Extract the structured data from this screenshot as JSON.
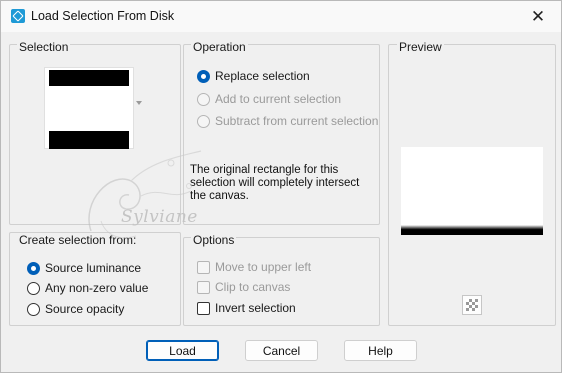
{
  "window": {
    "title": "Load Selection From Disk",
    "close_glyph": "✕"
  },
  "selection": {
    "title": "Selection"
  },
  "operation": {
    "title": "Operation",
    "options": [
      {
        "label": "Replace selection",
        "selected": true,
        "enabled": true
      },
      {
        "label": "Add to current selection",
        "selected": false,
        "enabled": false
      },
      {
        "label": "Subtract from current selection",
        "selected": false,
        "enabled": false
      }
    ],
    "info": "The original rectangle for this selection will completely intersect the canvas."
  },
  "preview": {
    "title": "Preview"
  },
  "create_from": {
    "title": "Create selection from:",
    "options": [
      {
        "label": "Source luminance",
        "selected": true
      },
      {
        "label": "Any non-zero value",
        "selected": false
      },
      {
        "label": "Source opacity",
        "selected": false
      }
    ]
  },
  "options": {
    "title": "Options",
    "items": [
      {
        "label": "Move to upper left",
        "checked": false,
        "enabled": false
      },
      {
        "label": "Clip to canvas",
        "checked": false,
        "enabled": false
      },
      {
        "label": "Invert selection",
        "checked": false,
        "enabled": true
      }
    ]
  },
  "buttons": {
    "load": "Load",
    "cancel": "Cancel",
    "help": "Help"
  },
  "watermark": "Sylviane",
  "colors": {
    "accent": "#005fb8",
    "background": "#f0f0f0"
  }
}
